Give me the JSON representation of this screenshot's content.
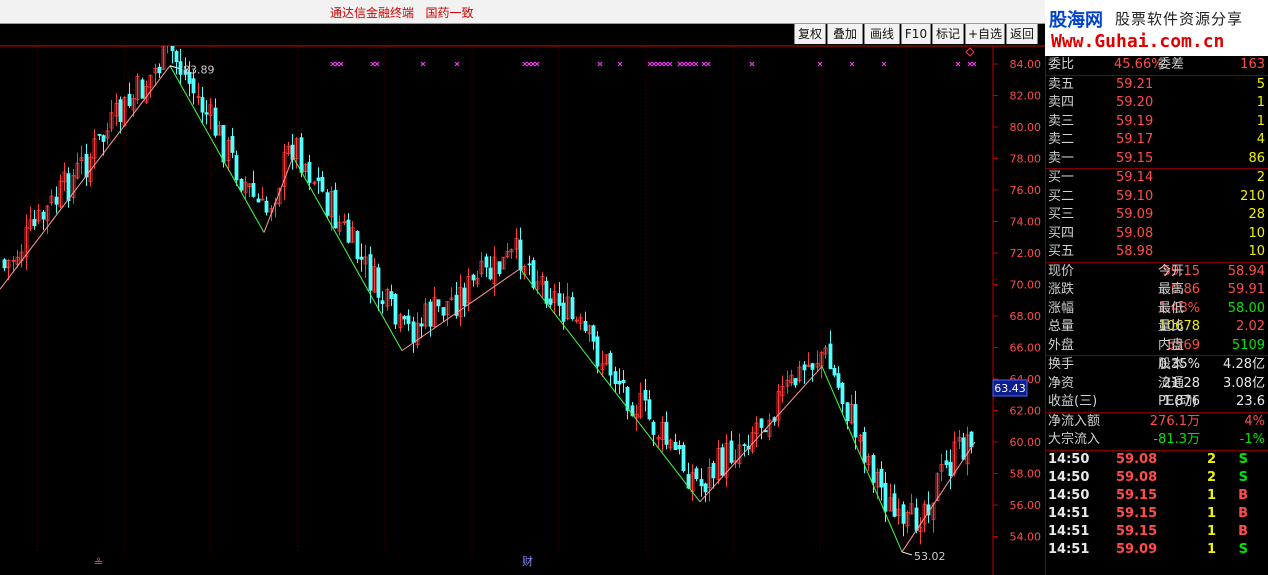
{
  "app": {
    "title": "通达信金融终端   国药一致"
  },
  "toolbar": {
    "buttons": [
      "复权",
      "叠加",
      "画线",
      "F10",
      "标记",
      "+自选",
      "返回"
    ]
  },
  "logo": {
    "name": "股海网",
    "slogan": "股票软件资源分享",
    "url": "Www.Guhai.com.cn"
  },
  "chart": {
    "price_axis": [
      "84.00",
      "82.00",
      "80.00",
      "78.00",
      "76.00",
      "74.00",
      "72.00",
      "70.00",
      "68.00",
      "66.00",
      "64.00",
      "62.00",
      "60.00",
      "58.00",
      "56.00",
      "54.00"
    ],
    "current_price_tag": "63.43",
    "high_label": "83.89",
    "low_label": "53.02",
    "bottom_markers": [
      "≗",
      "财"
    ],
    "colors": {
      "up": "#ff3c3c",
      "down": "#54ffff",
      "zigzag_up": "#ff9a9a",
      "zigzag_down": "#40ff40",
      "marker": "#ff40ff",
      "axis": "#c00000"
    }
  },
  "quote": {
    "order_ratio": {
      "label": "委比",
      "value": "45.66%",
      "label2": "委差",
      "value2": "163"
    },
    "sells": [
      {
        "label": "卖五",
        "price": "59.21",
        "vol": "5"
      },
      {
        "label": "卖四",
        "price": "59.20",
        "vol": "1"
      },
      {
        "label": "卖三",
        "price": "59.19",
        "vol": "1"
      },
      {
        "label": "卖二",
        "price": "59.17",
        "vol": "4"
      },
      {
        "label": "卖一",
        "price": "59.15",
        "vol": "86"
      }
    ],
    "buys": [
      {
        "label": "买一",
        "price": "59.14",
        "vol": "2"
      },
      {
        "label": "买二",
        "price": "59.10",
        "vol": "210"
      },
      {
        "label": "买三",
        "price": "59.09",
        "vol": "28"
      },
      {
        "label": "买四",
        "price": "59.08",
        "vol": "10"
      },
      {
        "label": "买五",
        "price": "58.98",
        "vol": "10"
      }
    ],
    "stats": [
      {
        "l1": "现价",
        "v1": "59.15",
        "l2": "今开",
        "v2": "58.94",
        "c1": "red",
        "c2": "red"
      },
      {
        "l1": "涨跌",
        "v1": "0.86",
        "l2": "最高",
        "v2": "59.91",
        "c1": "red",
        "c2": "red"
      },
      {
        "l1": "涨幅",
        "v1": "1.48%",
        "l2": "最低",
        "v2": "58.00",
        "c1": "red",
        "c2": "green"
      },
      {
        "l1": "总量",
        "v1": "10678",
        "l2": "量比",
        "v2": "2.02",
        "c1": "yellow",
        "c2": "red"
      },
      {
        "l1": "外盘",
        "v1": "5569",
        "l2": "内盘",
        "v2": "5109",
        "c1": "red",
        "c2": "green"
      }
    ],
    "fundamentals": [
      {
        "l1": "换手",
        "v1": "0.35%",
        "l2": "股本",
        "v2": "4.28亿"
      },
      {
        "l1": "净资",
        "v1": "21.28",
        "l2": "流通",
        "v2": "3.08亿"
      },
      {
        "l1": "收益(三)",
        "v1": "1.876",
        "l2": "PE(动)",
        "v2": "23.6"
      }
    ],
    "flows": [
      {
        "label": "净流入额",
        "value": "276.1万",
        "pct": "4%",
        "color": "red"
      },
      {
        "label": "大宗流入",
        "value": "-81.3万",
        "pct": "-1%",
        "color": "green"
      }
    ],
    "ticks": [
      {
        "time": "14:50",
        "price": "59.08",
        "vol": "2",
        "side": "S"
      },
      {
        "time": "14:50",
        "price": "59.08",
        "vol": "2",
        "side": "S"
      },
      {
        "time": "14:50",
        "price": "59.15",
        "vol": "1",
        "side": "B"
      },
      {
        "time": "14:51",
        "price": "59.15",
        "vol": "1",
        "side": "B"
      },
      {
        "time": "14:51",
        "price": "59.15",
        "vol": "1",
        "side": "B"
      },
      {
        "time": "14:51",
        "price": "59.09",
        "vol": "1",
        "side": "S"
      }
    ]
  }
}
